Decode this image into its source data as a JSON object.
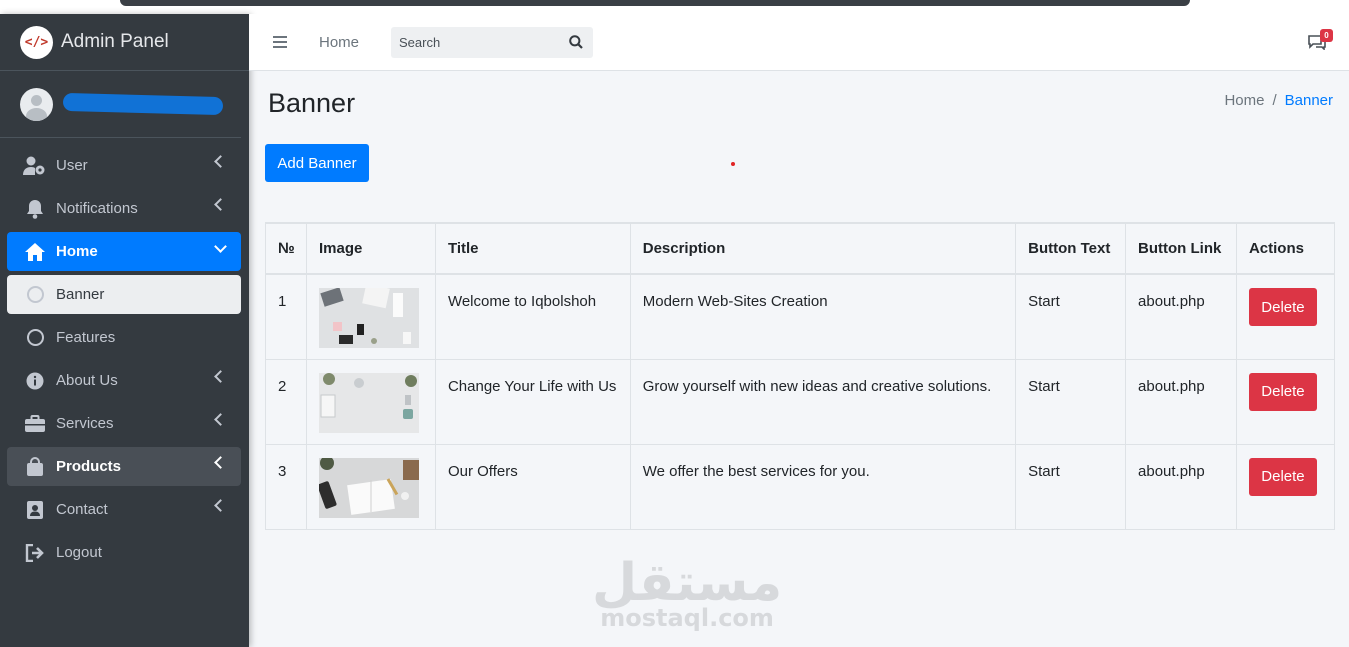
{
  "brand": {
    "title": "Admin Panel",
    "logo_text": "</>"
  },
  "sidebar": {
    "items": [
      {
        "label": "User",
        "icon": "user-cog-icon"
      },
      {
        "label": "Notifications",
        "icon": "bell-icon"
      },
      {
        "label": "Home",
        "icon": "home-icon"
      },
      {
        "label": "Banner",
        "icon": "circle-icon"
      },
      {
        "label": "Features",
        "icon": "circle-icon"
      },
      {
        "label": "About Us",
        "icon": "info-icon"
      },
      {
        "label": "Services",
        "icon": "briefcase-icon"
      },
      {
        "label": "Products",
        "icon": "shopping-bag-icon"
      },
      {
        "label": "Contact",
        "icon": "contact-card-icon"
      },
      {
        "label": "Logout",
        "icon": "logout-icon"
      }
    ]
  },
  "navbar": {
    "home_link": "Home",
    "search_placeholder": "Search",
    "messages_count": "0"
  },
  "page": {
    "title": "Banner",
    "breadcrumb": {
      "home": "Home",
      "separator": "/",
      "current": "Banner"
    },
    "add_button": "Add Banner"
  },
  "table": {
    "headers": [
      "№",
      "Image",
      "Title",
      "Description",
      "Button Text",
      "Button Link",
      "Actions"
    ],
    "rows": [
      {
        "num": "1",
        "title": "Welcome to Iqbolshoh",
        "description": "Modern Web-Sites Creation",
        "button_text": "Start",
        "button_link": "about.php",
        "action": "Delete"
      },
      {
        "num": "2",
        "title": "Change Your Life with Us",
        "description": "Grow yourself with new ideas and creative solutions.",
        "button_text": "Start",
        "button_link": "about.php",
        "action": "Delete"
      },
      {
        "num": "3",
        "title": "Our Offers",
        "description": "We offer the best services for you.",
        "button_text": "Start",
        "button_link": "about.php",
        "action": "Delete"
      }
    ]
  },
  "watermark": {
    "arabic": "مستقل",
    "latin": "mostaql.com"
  },
  "colors": {
    "primary": "#007bff",
    "danger": "#dc3545",
    "sidebar": "#343a40"
  }
}
